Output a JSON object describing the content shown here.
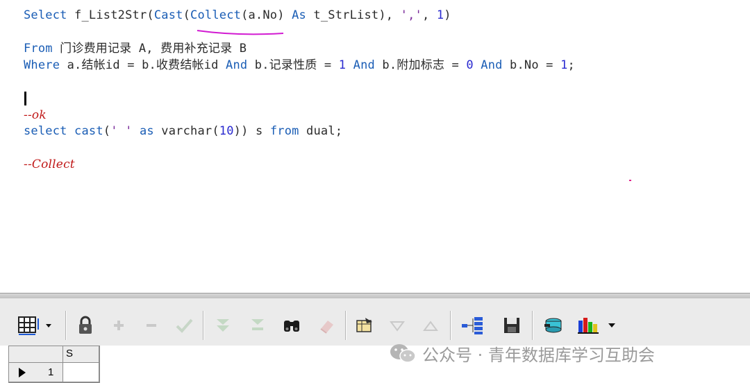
{
  "editor": {
    "line1": {
      "t1": "Select",
      "t2": " f_List2Str(",
      "t3": "Cast",
      "t4": "(",
      "t5": "Collect",
      "t6": "(a.No) ",
      "t7": "As",
      "t8": " t_StrList), ",
      "t9": "','",
      "t10": ", ",
      "t11": "1",
      "t12": ")"
    },
    "line2": {
      "t1": "From",
      "t2": " 门诊费用记录 A, 费用补充记录 B"
    },
    "line3": {
      "t1": "Where",
      "t2": " a.结帐id = b.收费结帐id ",
      "t3": "And",
      "t4": " b.记录性质 = ",
      "t5": "1",
      "t6": " ",
      "t7": "And",
      "t8": " b.附加标志 = ",
      "t9": "0",
      "t10": " ",
      "t11": "And",
      "t12": " b.No = ",
      "t13": "1",
      "t14": ";"
    },
    "comment_ok": "--ok",
    "line5": {
      "t1": "select",
      "t2": " ",
      "t3": "cast",
      "t4": "(",
      "t5": "' '",
      "t6": " ",
      "t7": "as",
      "t8": " varchar(",
      "t9": "10",
      "t10": ")) s ",
      "t11": "from",
      "t12": " dual;"
    },
    "comment_collect": "--Collect"
  },
  "toolbar": {
    "icons": [
      "grid-options-icon",
      "lock-icon",
      "plus-icon",
      "minus-icon",
      "check-icon",
      "filter-down-icon",
      "filter-icon",
      "binoculars-icon",
      "eraser-icon",
      "table-refresh-icon",
      "triangle-down-icon",
      "triangle-up-icon",
      "tree-icon",
      "save-icon",
      "database-icon",
      "bar-chart-icon"
    ]
  },
  "result_grid": {
    "columns": [
      "S"
    ],
    "rows": [
      {
        "row_number": "1",
        "value": ""
      }
    ]
  },
  "watermark": {
    "text": "公众号 · 青年数据库学习互助会"
  },
  "colors": {
    "keyword": "#1a5db5",
    "comment": "#c01818",
    "number": "#2a2ad0",
    "toolbar_bg": "#ebebeb"
  }
}
